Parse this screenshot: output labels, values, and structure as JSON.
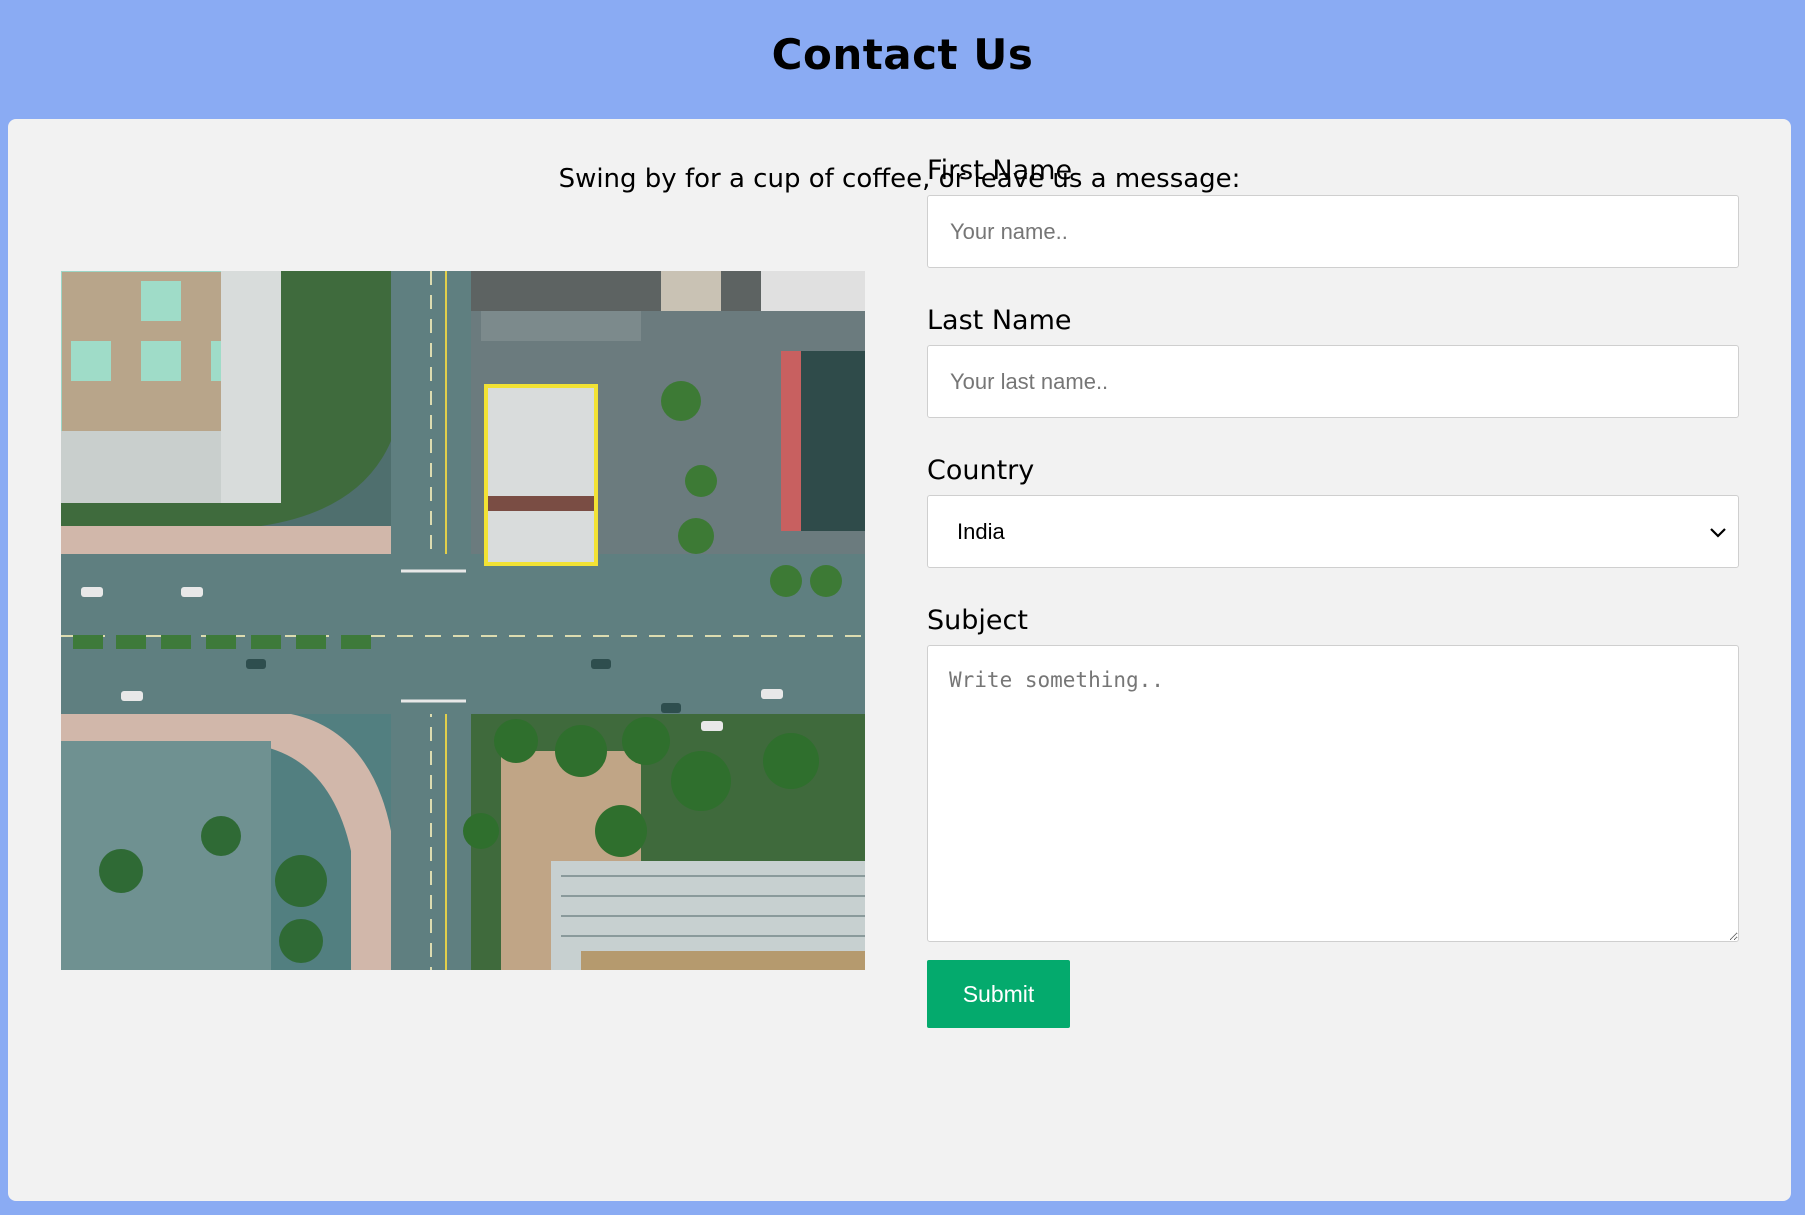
{
  "header": {
    "title": "Contact Us"
  },
  "intro": {
    "text": "Swing by for a cup of coffee, or leave us a message:"
  },
  "image": {
    "description_icon": "aerial-city-intersection-image"
  },
  "form": {
    "first_name": {
      "label": "First Name",
      "placeholder": "Your name.."
    },
    "last_name": {
      "label": "Last Name",
      "placeholder": "Your last name.."
    },
    "country": {
      "label": "Country",
      "selected": "India"
    },
    "subject": {
      "label": "Subject",
      "placeholder": "Write something.."
    },
    "submit_label": "Submit"
  },
  "colors": {
    "page_background": "#8aabf3",
    "card_background": "#f2f2f2",
    "submit_background": "#04aa6d"
  }
}
